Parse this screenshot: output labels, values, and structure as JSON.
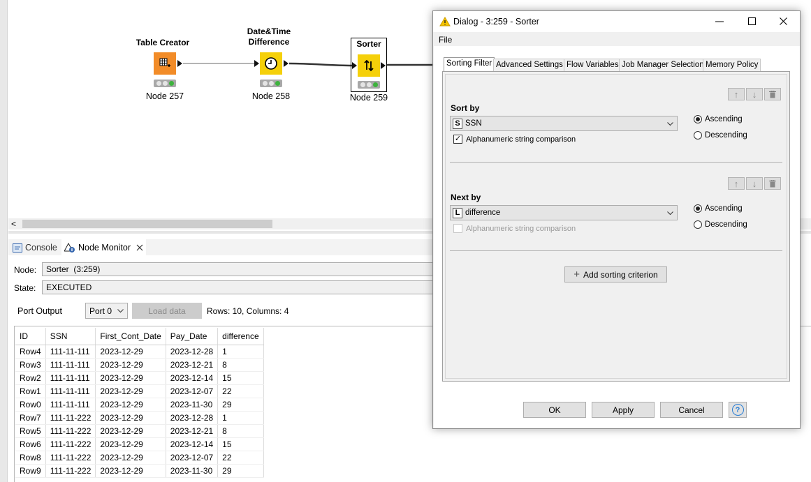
{
  "workflow": {
    "nodes": [
      {
        "title": "Table Creator",
        "label": "Node 257"
      },
      {
        "title_line1": "Date&Time",
        "title_line2": "Difference",
        "label": "Node 258"
      },
      {
        "title": "Sorter",
        "label": "Node 259"
      }
    ],
    "hscroll_left": "<"
  },
  "colors": {
    "table_creator": "#f28c28",
    "date_diff": "#f5d00a",
    "sorter": "#f5d00a",
    "traffic_green": "#3db33d"
  },
  "panel": {
    "tabs": [
      {
        "label": "Console",
        "icon": "console-icon"
      },
      {
        "label": "Node Monitor",
        "icon": "node-monitor-icon"
      }
    ],
    "node_label": "Node:",
    "node_value": "Sorter  (3:259)",
    "state_label": "State:",
    "state_value": "EXECUTED",
    "port_output_label": "Port Output",
    "port_select": "Port 0",
    "load_data": "Load data",
    "rows_info": "Rows: 10, Columns: 4"
  },
  "table": {
    "columns": [
      "ID",
      "SSN",
      "First_Cont_Date",
      "Pay_Date",
      "difference"
    ],
    "rows": [
      [
        "Row4",
        "111-11-111",
        "2023-12-29",
        "2023-12-28",
        "1"
      ],
      [
        "Row3",
        "111-11-111",
        "2023-12-29",
        "2023-12-21",
        "8"
      ],
      [
        "Row2",
        "111-11-111",
        "2023-12-29",
        "2023-12-14",
        "15"
      ],
      [
        "Row1",
        "111-11-111",
        "2023-12-29",
        "2023-12-07",
        "22"
      ],
      [
        "Row0",
        "111-11-111",
        "2023-12-29",
        "2023-11-30",
        "29"
      ],
      [
        "Row7",
        "111-11-222",
        "2023-12-29",
        "2023-12-28",
        "1"
      ],
      [
        "Row5",
        "111-11-222",
        "2023-12-29",
        "2023-12-21",
        "8"
      ],
      [
        "Row6",
        "111-11-222",
        "2023-12-29",
        "2023-12-14",
        "15"
      ],
      [
        "Row8",
        "111-11-222",
        "2023-12-29",
        "2023-12-07",
        "22"
      ],
      [
        "Row9",
        "111-11-222",
        "2023-12-29",
        "2023-11-30",
        "29"
      ]
    ]
  },
  "dialog": {
    "title": "Dialog - 3:259 - Sorter",
    "menu_file": "File",
    "tabs": [
      "Sorting Filter",
      "Advanced Settings",
      "Flow Variables",
      "Job Manager Selection",
      "Memory Policy"
    ],
    "criteria": [
      {
        "heading": "Sort by",
        "type_badge": "S",
        "column": "SSN",
        "alnum": "Alphanumeric string comparison",
        "ascending": "Ascending",
        "descending": "Descending"
      },
      {
        "heading": "Next by",
        "type_badge": "L",
        "column": "difference",
        "alnum": "Alphanumeric string comparison",
        "ascending": "Ascending",
        "descending": "Descending"
      }
    ],
    "add_criterion": "Add sorting criterion",
    "ok": "OK",
    "apply": "Apply",
    "cancel": "Cancel",
    "help": "?"
  }
}
